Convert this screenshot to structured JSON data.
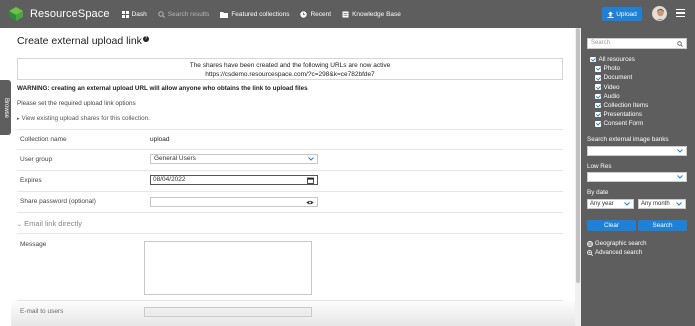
{
  "header": {
    "brand": "ResourceSpace",
    "nav": [
      {
        "label": "Dash",
        "icon": "dash-grid-icon"
      },
      {
        "label": "Search results",
        "icon": "search-icon",
        "dimmed": true
      },
      {
        "label": "Featured collections",
        "icon": "folder-icon"
      },
      {
        "label": "Recent",
        "icon": "clock-icon"
      },
      {
        "label": "Knowledge Base",
        "icon": "book-icon"
      }
    ],
    "upload_label": "Upload"
  },
  "browse_tab": "Browse",
  "main": {
    "title": "Create external upload link",
    "notice_line1": "The shares have been created and the following URLs are now active",
    "notice_line2": "https://csdemo.resourcespace.com/?c=298&k=ce782bfde7",
    "warning": "WARNING: creating an external upload URL will allow anyone who obtains the link to upload files",
    "set_options": "Please set the required upload link options",
    "view_shares": "View existing upload shares for this collection.",
    "form": {
      "collection_label": "Collection name",
      "collection_value": "upload",
      "user_group_label": "User group",
      "user_group_value": "General Users",
      "expires_label": "Expires",
      "expires_value": "08/04/2022",
      "password_label": "Share password (optional)",
      "password_value": "",
      "email_link_toggle": "Email link directly",
      "message_label": "Message",
      "email_users_label": "E-mail to users"
    }
  },
  "sidebar": {
    "search_placeholder": "Search",
    "resource_types": [
      {
        "label": "All resources",
        "checked": true,
        "sub": false
      },
      {
        "label": "Photo",
        "checked": true,
        "sub": true
      },
      {
        "label": "Document",
        "checked": true,
        "sub": true
      },
      {
        "label": "Video",
        "checked": true,
        "sub": true
      },
      {
        "label": "Audio",
        "checked": true,
        "sub": true
      },
      {
        "label": "Collection Items",
        "checked": true,
        "sub": true
      },
      {
        "label": "Presentations",
        "checked": true,
        "sub": true
      },
      {
        "label": "Consent Form",
        "checked": true,
        "sub": true
      }
    ],
    "external_banks_label": "Search external image banks",
    "external_banks_value": "",
    "lowres_label": "Low Res",
    "lowres_value": "",
    "bydate_label": "By date",
    "year_value": "Any year",
    "month_value": "Any month",
    "clear_label": "Clear",
    "search_label": "Search",
    "geo_search": "Geographic search",
    "advanced_search": "Advanced search"
  },
  "colors": {
    "header_bg": "#5e5e5e",
    "accent": "#1e80d6",
    "logo_green": "#3fae49"
  }
}
